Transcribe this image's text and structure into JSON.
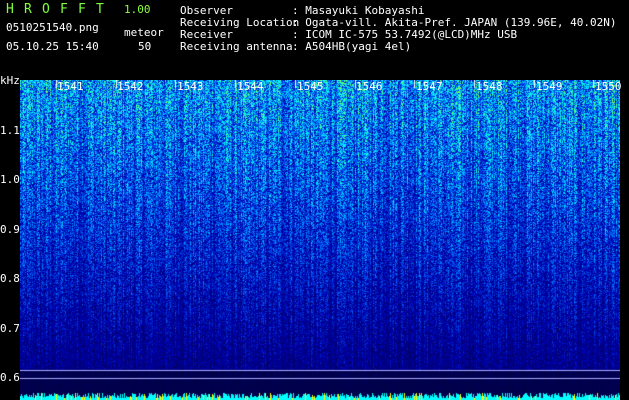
{
  "header": {
    "app_letters": [
      "H",
      "R",
      "O",
      "F",
      "F",
      "T"
    ],
    "version": "1.00",
    "filename": "0510251540.png",
    "mode_label": "meteor",
    "timestamp": "05.10.25 15:40",
    "count": "50"
  },
  "info": {
    "observer_label": "Observer",
    "observer_value": ": Masayuki Kobayashi",
    "location_label": "Receiving Location",
    "location_value": ": Ogata-vill. Akita-Pref. JAPAN (139.96E, 40.02N)",
    "receiver_label": "Receiver",
    "receiver_value": ": ICOM IC-575 53.7492(@LCD)MHz USB",
    "antenna_label": "Receiving antenna",
    "antenna_value": ": A504HB(yagi 4el)"
  },
  "plot": {
    "y_unit": "kHz",
    "y_ticks": [
      "1.1",
      "1.0",
      "0.9",
      "0.8",
      "0.7",
      "0.6"
    ],
    "minute_labels": [
      "1541",
      "1542",
      "1543",
      "1544",
      "1545",
      "1546",
      "1547",
      "1548",
      "1549",
      "1550"
    ],
    "colors": {
      "low": "#00008f",
      "mid": "#0050ff",
      "high": "#00ffff",
      "peak": "#7fff00"
    }
  }
}
